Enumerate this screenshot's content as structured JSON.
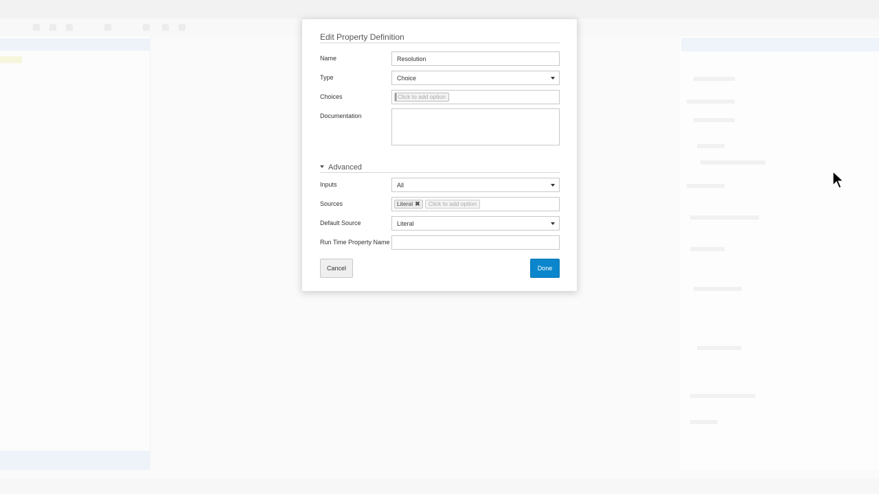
{
  "modal": {
    "title": "Edit Property Definition",
    "name": {
      "label": "Name",
      "value": "Resolution"
    },
    "type": {
      "label": "Type",
      "value": "Choice"
    },
    "choices": {
      "label": "Choices",
      "add_option_text": "Click to add option"
    },
    "documentation": {
      "label": "Documentation",
      "value": ""
    },
    "advanced": {
      "label": "Advanced",
      "expanded": true,
      "inputs": {
        "label": "Inputs",
        "value": "All"
      },
      "sources": {
        "label": "Sources",
        "tokens": [
          "Literal"
        ],
        "add_option_text": "Click to add option"
      },
      "default_source": {
        "label": "Default Source",
        "value": "Literal"
      },
      "run_time_property_name": {
        "label": "Run Time Property Name",
        "value": ""
      }
    },
    "buttons": {
      "cancel": "Cancel",
      "done": "Done"
    }
  },
  "colors": {
    "primary_button": "#0b86cc",
    "modal_background": "#ffffff",
    "page_background": "#fafafa"
  },
  "icons": {
    "dropdown": "chevron-down-icon",
    "token_remove": "close-icon",
    "section_toggle": "caret-down-icon",
    "cursor": "mouse-pointer-icon"
  }
}
